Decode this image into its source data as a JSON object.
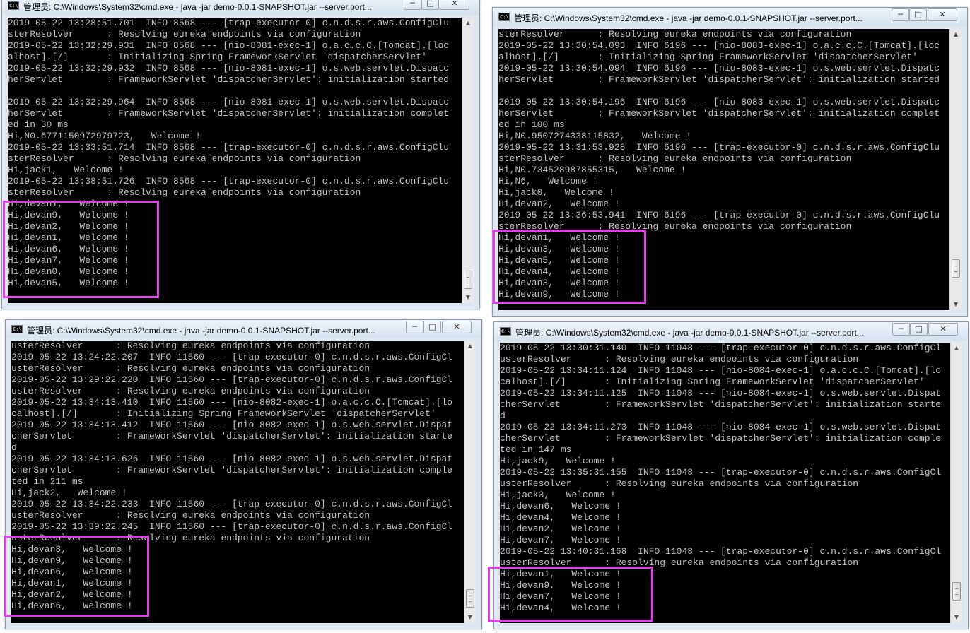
{
  "colors": {
    "highlight": "#e23fe8",
    "console_bg": "#000000",
    "console_text": "#c0c0c0"
  },
  "window_controls": {
    "minimize": "─",
    "maximize": "□",
    "close": "✕"
  },
  "windows": [
    {
      "title": "管理员: C:\\Windows\\System32\\cmd.exe - java  -jar demo-0.0.1-SNAPSHOT.jar --server.port...",
      "lines": [
        "2019-05-22 13:28:51.701  INFO 8568 --- [trap-executor-0] c.n.d.s.r.aws.ConfigClu",
        "sterResolver      : Resolving eureka endpoints via configuration",
        "2019-05-22 13:32:29.931  INFO 8568 --- [nio-8081-exec-1] o.a.c.c.C.[Tomcat].[loc",
        "alhost].[/]       : Initializing Spring FrameworkServlet 'dispatcherServlet'",
        "2019-05-22 13:32:29.932  INFO 8568 --- [nio-8081-exec-1] o.s.web.servlet.Dispatc",
        "herServlet        : FrameworkServlet 'dispatcherServlet': initialization started",
        "",
        "2019-05-22 13:32:29.964  INFO 8568 --- [nio-8081-exec-1] o.s.web.servlet.Dispatc",
        "herServlet        : FrameworkServlet 'dispatcherServlet': initialization complet",
        "ed in 30 ms",
        "Hi,N0.6771150972979723,   Welcome !",
        "2019-05-22 13:33:51.714  INFO 8568 --- [trap-executor-0] c.n.d.s.r.aws.ConfigClu",
        "sterResolver      : Resolving eureka endpoints via configuration",
        "Hi,jack1,   Welcome !",
        "2019-05-22 13:38:51.726  INFO 8568 --- [trap-executor-0] c.n.d.s.r.aws.ConfigClu",
        "sterResolver      : Resolving eureka endpoints via configuration",
        "Hi,devan1,   Welcome !",
        "Hi,devan9,   Welcome !",
        "Hi,devan2,   Welcome !",
        "Hi,devan1,   Welcome !",
        "Hi,devan6,   Welcome !",
        "Hi,devan7,   Welcome !",
        "Hi,devan0,   Welcome !",
        "Hi,devan5,   Welcome !"
      ]
    },
    {
      "title": "管理员: C:\\Windows\\System32\\cmd.exe - java  -jar demo-0.0.1-SNAPSHOT.jar --server.port...",
      "lines": [
        "sterResolver      : Resolving eureka endpoints via configuration",
        "2019-05-22 13:30:54.093  INFO 6196 --- [nio-8083-exec-1] o.a.c.c.C.[Tomcat].[loc",
        "alhost].[/]       : Initializing Spring FrameworkServlet 'dispatcherServlet'",
        "2019-05-22 13:30:54.094  INFO 6196 --- [nio-8083-exec-1] o.s.web.servlet.Dispatc",
        "herServlet        : FrameworkServlet 'dispatcherServlet': initialization started",
        "",
        "2019-05-22 13:30:54.196  INFO 6196 --- [nio-8083-exec-1] o.s.web.servlet.Dispatc",
        "herServlet        : FrameworkServlet 'dispatcherServlet': initialization complet",
        "ed in 100 ms",
        "Hi,N0.9507274338115832,   Welcome !",
        "2019-05-22 13:31:53.928  INFO 6196 --- [trap-executor-0] c.n.d.s.r.aws.ConfigClu",
        "sterResolver      : Resolving eureka endpoints via configuration",
        "Hi,N0.734528987855315,   Welcome !",
        "Hi,N6,   Welcome !",
        "Hi,jack0,   Welcome !",
        "Hi,devan2,   Welcome !",
        "2019-05-22 13:36:53.941  INFO 6196 --- [trap-executor-0] c.n.d.s.r.aws.ConfigClu",
        "sterResolver      : Resolving eureka endpoints via configuration",
        "Hi,devan1,   Welcome !",
        "Hi,devan3,   Welcome !",
        "Hi,devan5,   Welcome !",
        "Hi,devan4,   Welcome !",
        "Hi,devan3,   Welcome !",
        "Hi,devan9,   Welcome !"
      ]
    },
    {
      "title": "管理员: C:\\Windows\\System32\\cmd.exe - java  -jar demo-0.0.1-SNAPSHOT.jar --server.port...",
      "lines": [
        "usterResolver      : Resolving eureka endpoints via configuration",
        "2019-05-22 13:24:22.207  INFO 11560 --- [trap-executor-0] c.n.d.s.r.aws.ConfigCl",
        "usterResolver      : Resolving eureka endpoints via configuration",
        "2019-05-22 13:29:22.220  INFO 11560 --- [trap-executor-0] c.n.d.s.r.aws.ConfigCl",
        "usterResolver      : Resolving eureka endpoints via configuration",
        "2019-05-22 13:34:13.410  INFO 11560 --- [nio-8082-exec-1] o.a.c.c.C.[Tomcat].[lo",
        "calhost].[/]       : Initializing Spring FrameworkServlet 'dispatcherServlet'",
        "2019-05-22 13:34:13.412  INFO 11560 --- [nio-8082-exec-1] o.s.web.servlet.Dispat",
        "cherServlet        : FrameworkServlet 'dispatcherServlet': initialization starte",
        "d",
        "2019-05-22 13:34:13.626  INFO 11560 --- [nio-8082-exec-1] o.s.web.servlet.Dispat",
        "cherServlet        : FrameworkServlet 'dispatcherServlet': initialization comple",
        "ted in 211 ms",
        "Hi,jack2,   Welcome !",
        "2019-05-22 13:34:22.233  INFO 11560 --- [trap-executor-0] c.n.d.s.r.aws.ConfigCl",
        "usterResolver      : Resolving eureka endpoints via configuration",
        "2019-05-22 13:39:22.245  INFO 11560 --- [trap-executor-0] c.n.d.s.r.aws.ConfigCl",
        "usterResolver      : Resolving eureka endpoints via configuration",
        "Hi,devan8,   Welcome !",
        "Hi,devan9,   Welcome !",
        "Hi,devan6,   Welcome !",
        "Hi,devan1,   Welcome !",
        "Hi,devan2,   Welcome !",
        "Hi,devan6,   Welcome !"
      ]
    },
    {
      "title": "管理员: C:\\Windows\\System32\\cmd.exe - java  -jar demo-0.0.1-SNAPSHOT.jar --server.port...",
      "lines": [
        "2019-05-22 13:30:31.140  INFO 11048 --- [trap-executor-0] c.n.d.s.r.aws.ConfigCl",
        "usterResolver      : Resolving eureka endpoints via configuration",
        "2019-05-22 13:34:11.124  INFO 11048 --- [nio-8084-exec-1] o.a.c.c.C.[Tomcat].[lo",
        "calhost].[/]       : Initializing Spring FrameworkServlet 'dispatcherServlet'",
        "2019-05-22 13:34:11.125  INFO 11048 --- [nio-8084-exec-1] o.s.web.servlet.Dispat",
        "cherServlet        : FrameworkServlet 'dispatcherServlet': initialization starte",
        "d",
        "2019-05-22 13:34:11.273  INFO 11048 --- [nio-8084-exec-1] o.s.web.servlet.Dispat",
        "cherServlet        : FrameworkServlet 'dispatcherServlet': initialization comple",
        "ted in 147 ms",
        "Hi,jack9,   Welcome !",
        "2019-05-22 13:35:31.155  INFO 11048 --- [trap-executor-0] c.n.d.s.r.aws.ConfigCl",
        "usterResolver      : Resolving eureka endpoints via configuration",
        "Hi,jack3,   Welcome !",
        "Hi,devan6,   Welcome !",
        "Hi,devan4,   Welcome !",
        "Hi,devan2,   Welcome !",
        "Hi,devan7,   Welcome !",
        "2019-05-22 13:40:31.168  INFO 11048 --- [trap-executor-0] c.n.d.s.r.aws.ConfigCl",
        "usterResolver      : Resolving eureka endpoints via configuration",
        "Hi,devan1,   Welcome !",
        "Hi,devan9,   Welcome !",
        "Hi,devan7,   Welcome !",
        "Hi,devan4,   Welcome !"
      ]
    }
  ]
}
